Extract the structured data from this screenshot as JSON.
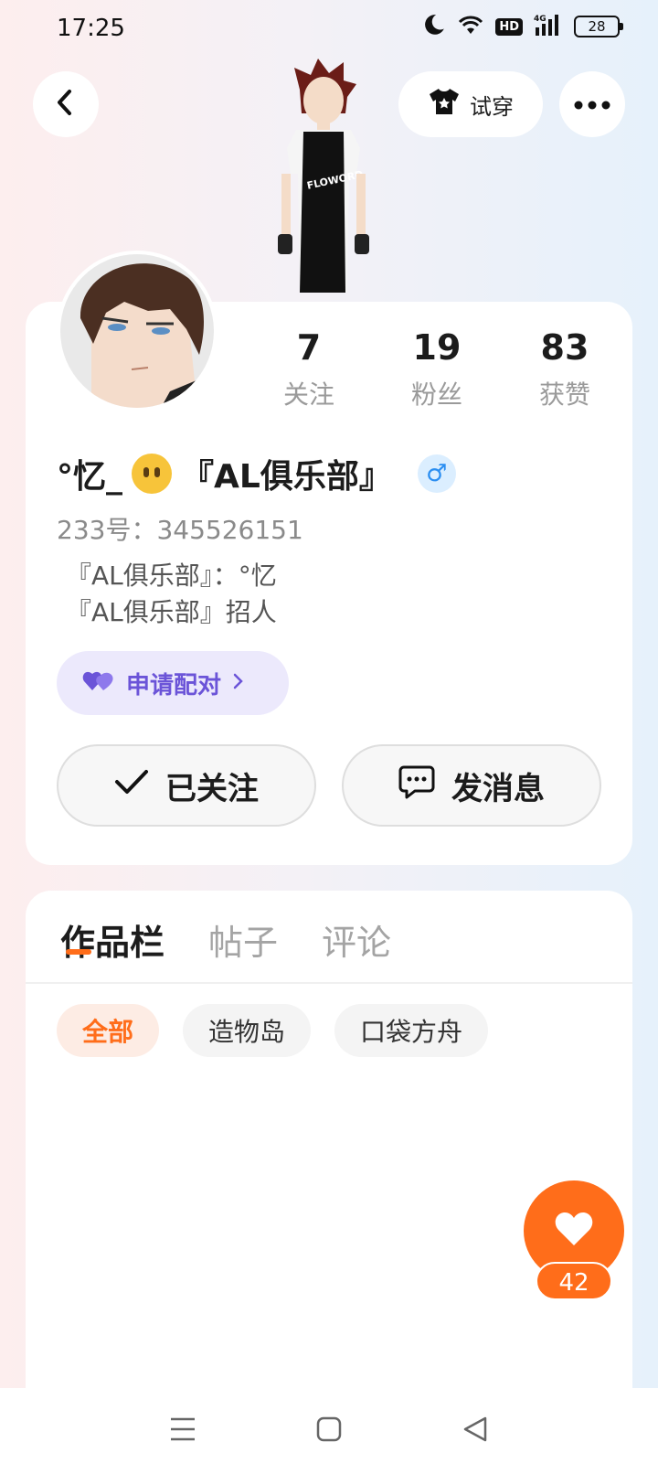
{
  "status_bar": {
    "time": "17:25",
    "network": "4G",
    "hd_label": "HD",
    "battery": "28"
  },
  "nav": {
    "tryon_label": "试穿"
  },
  "stats": [
    {
      "value": "7",
      "label": "关注"
    },
    {
      "value": "19",
      "label": "粉丝"
    },
    {
      "value": "83",
      "label": "获赞"
    }
  ],
  "profile": {
    "name_prefix": "°忆_",
    "name_suffix": "『AL俱乐部』",
    "gender_symbol": "♂",
    "account_id": "233号：345526151",
    "bio_lines": [
      "『AL俱乐部』：°忆",
      "『AL俱乐部』招人"
    ]
  },
  "match_button": {
    "label": "申请配对"
  },
  "actions": {
    "follow_label": "已关注",
    "message_label": "发消息"
  },
  "tabs": [
    {
      "label": "作品栏",
      "active": true
    },
    {
      "label": "帖子",
      "active": false
    },
    {
      "label": "评论",
      "active": false
    }
  ],
  "filters": [
    {
      "label": "全部",
      "active": true
    },
    {
      "label": "造物岛",
      "active": false
    },
    {
      "label": "口袋方舟",
      "active": false
    }
  ],
  "like_fab": {
    "count": "42"
  },
  "colors": {
    "accent": "#ff6d1a",
    "match": "#6b54d8",
    "gender": "#2b8ef1"
  },
  "icons": [
    "back-icon",
    "tshirt-icon",
    "more-icon",
    "heart-icon",
    "checkmark-icon",
    "chat-icon",
    "male-icon",
    "menu-icon",
    "home-icon",
    "nav-back-icon"
  ]
}
